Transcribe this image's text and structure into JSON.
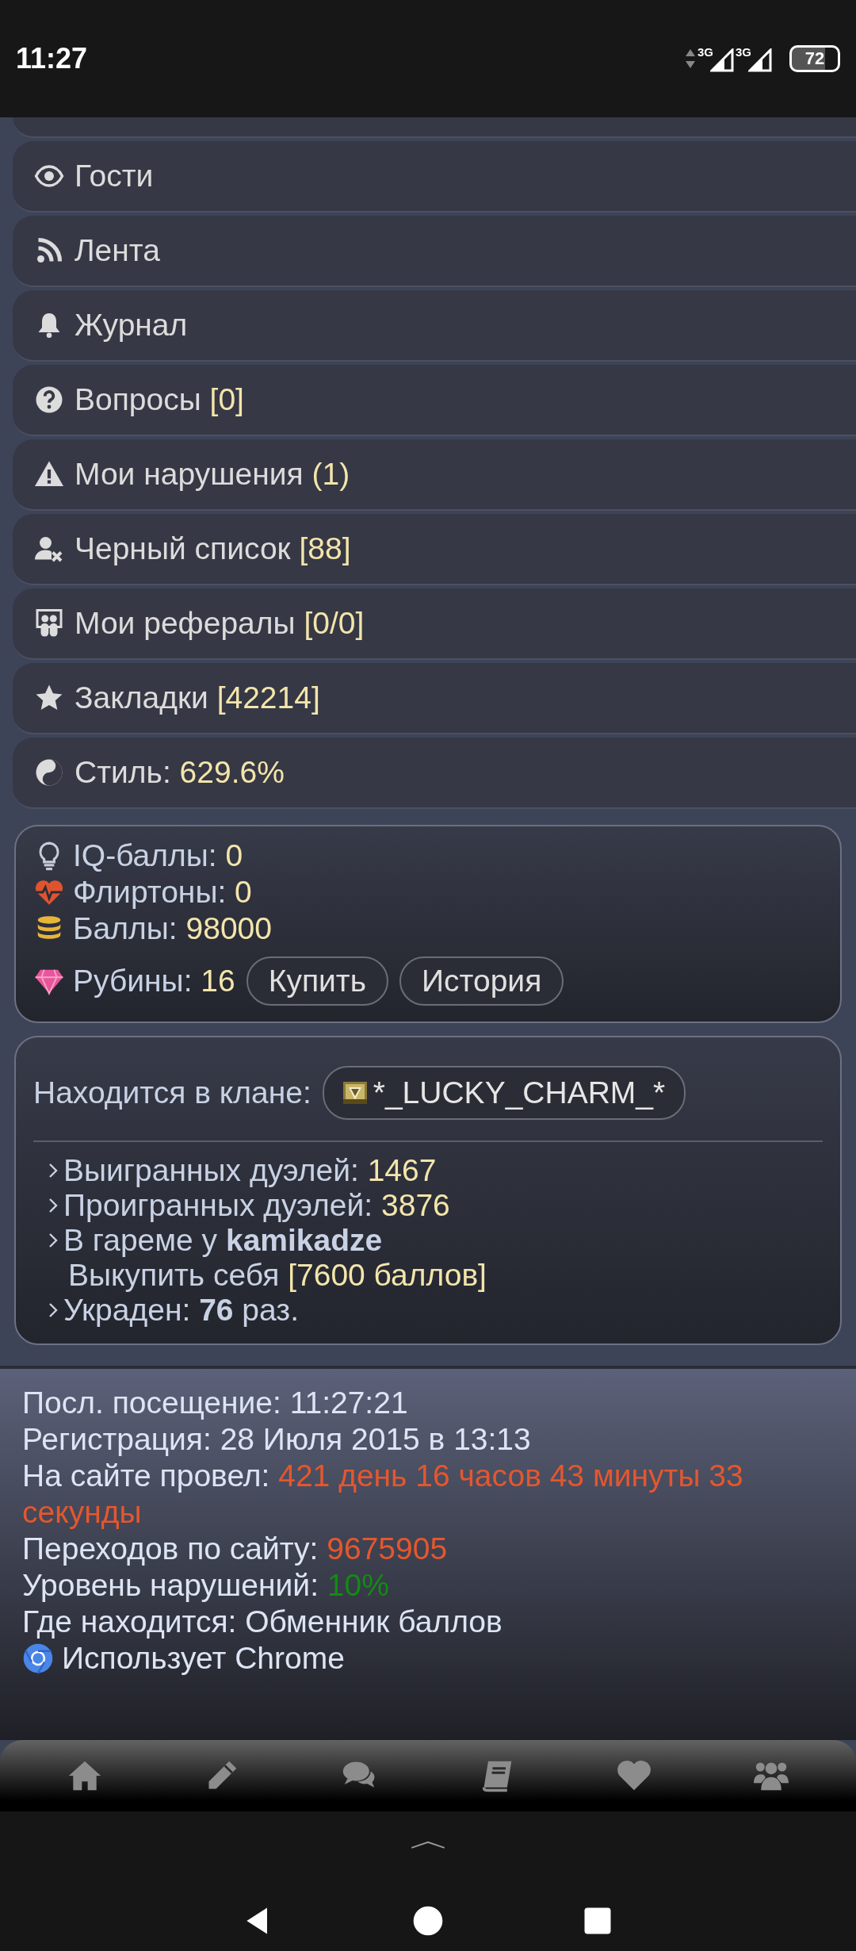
{
  "status_bar": {
    "time": "11:27",
    "network": [
      "3G",
      "3G"
    ],
    "battery": "72"
  },
  "menu": [
    {
      "kind": "guests",
      "label": "Гости"
    },
    {
      "kind": "feed",
      "label": "Лента"
    },
    {
      "kind": "journal",
      "label": "Журнал"
    },
    {
      "kind": "questions",
      "label": "Вопросы",
      "count": "[0]"
    },
    {
      "kind": "violations",
      "label": "Мои нарушения",
      "count": "(1)"
    },
    {
      "kind": "blacklist",
      "label": "Черный список",
      "count": "[88]"
    },
    {
      "kind": "referrals",
      "label": "Мои рефералы",
      "count": "[0/0]"
    },
    {
      "kind": "bookmarks",
      "label": "Закладки",
      "count": "[42214]"
    },
    {
      "kind": "style",
      "label": "Стиль:",
      "count": "629.6%"
    }
  ],
  "balances": [
    {
      "kind": "iq",
      "label": "IQ-баллы:",
      "value": "0"
    },
    {
      "kind": "flirt",
      "label": "Флиртоны:",
      "value": "0"
    },
    {
      "kind": "points",
      "label": "Баллы:",
      "value": "98000"
    },
    {
      "kind": "rubies",
      "label": "Рубины:",
      "value": "16",
      "buttons": [
        "Купить",
        "История"
      ]
    }
  ],
  "clan": {
    "label": "Находится в клане:",
    "name": "*_LUCKY_CHARM_*"
  },
  "duels": [
    {
      "kind": "stat",
      "text": "Выигранных дуэлей:",
      "value": "1467"
    },
    {
      "kind": "stat",
      "text": "Проигранных дуэлей:",
      "value": "3876"
    },
    {
      "kind": "rich",
      "text": "В гареме у **kamikadze**"
    },
    {
      "kind": "sub",
      "text": "Выкупить себя",
      "value": "[7600 баллов]"
    },
    {
      "kind": "rich",
      "text": "Украден: **76** раз."
    }
  ],
  "info": [
    {
      "label": "Посл. посещение: 11:27:21"
    },
    {
      "label": "Регистрация: 28 Июля 2015 в 13:13"
    },
    {
      "label": "На сайте провел:",
      "value": "421 день 16 часов 43 минуты 33 секунды",
      "color": "#e4572e"
    },
    {
      "label": "Переходов по сайту:",
      "value": "9675905",
      "color": "#e4572e"
    },
    {
      "label": "Уровень нарушений:",
      "value": "10%",
      "color": "#138a13"
    },
    {
      "label": "Где находится: Обменник баллов"
    },
    {
      "label": "Использует Chrome",
      "kind": "browser"
    }
  ],
  "bottom_nav": [
    {
      "kind": "home"
    },
    {
      "kind": "write"
    },
    {
      "kind": "chat"
    },
    {
      "kind": "book"
    },
    {
      "kind": "likes"
    },
    {
      "kind": "friends"
    }
  ]
}
